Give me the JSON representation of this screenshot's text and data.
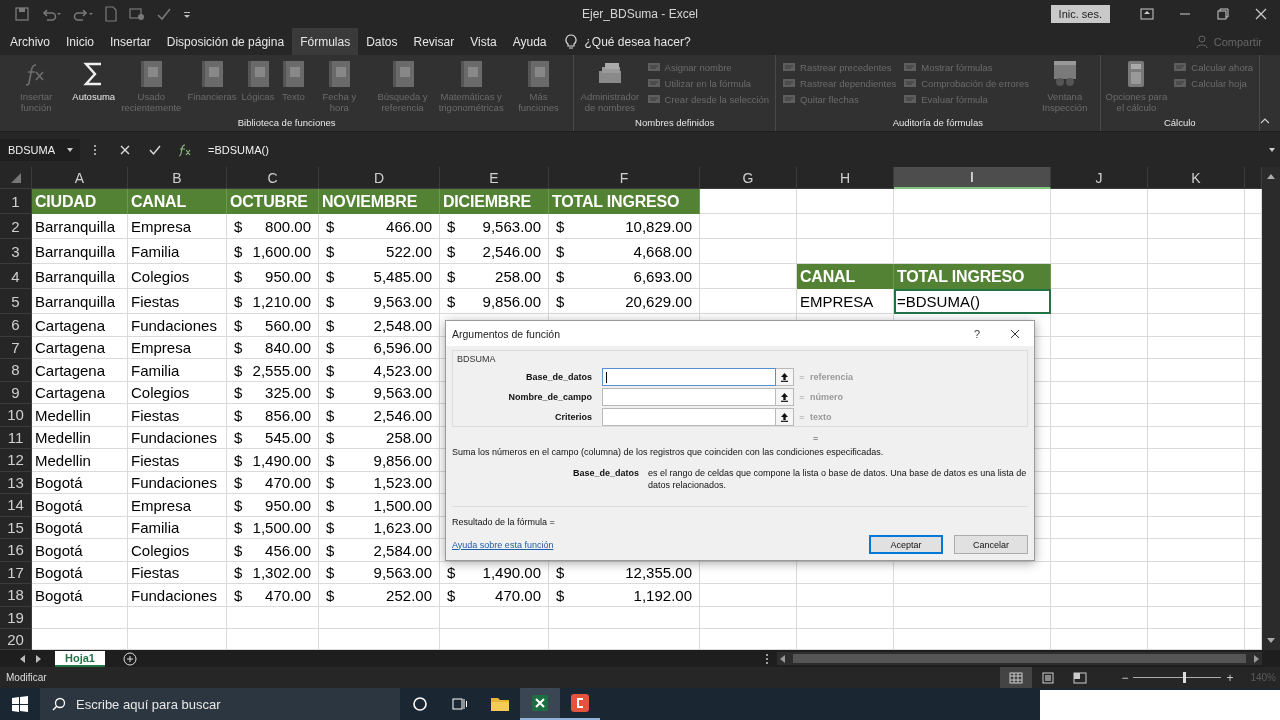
{
  "window": {
    "title": "Ejer_BDSuma  -  Excel",
    "sign_in": "Inic. ses."
  },
  "menu_tabs": [
    {
      "label": "Archivo",
      "selected": false
    },
    {
      "label": "Inicio",
      "selected": false
    },
    {
      "label": "Insertar",
      "selected": false
    },
    {
      "label": "Disposición de página",
      "selected": false
    },
    {
      "label": "Fórmulas",
      "selected": true
    },
    {
      "label": "Datos",
      "selected": false
    },
    {
      "label": "Revisar",
      "selected": false
    },
    {
      "label": "Vista",
      "selected": false
    },
    {
      "label": "Ayuda",
      "selected": false
    }
  ],
  "tell_me": "¿Qué desea hacer?",
  "share": {
    "label": "Compartir",
    "disabled": true
  },
  "ribbon": {
    "groups": [
      {
        "label": "Biblioteca de funciones",
        "items": [
          {
            "kind": "large",
            "label": "Insertar función",
            "disabled": true
          },
          {
            "kind": "large",
            "label": "Autosuma",
            "disabled": false
          },
          {
            "kind": "large",
            "label": "Usado recientemente",
            "disabled": true
          },
          {
            "kind": "large",
            "label": "Financieras",
            "disabled": true
          },
          {
            "kind": "large",
            "label": "Lógicas",
            "disabled": true
          },
          {
            "kind": "large",
            "label": "Texto",
            "disabled": true
          },
          {
            "kind": "large",
            "label": "Fecha y hora",
            "disabled": true
          },
          {
            "kind": "large",
            "label": "Búsqueda y referencia",
            "disabled": true
          },
          {
            "kind": "large",
            "label": "Matemáticas y trigonométricas",
            "disabled": true
          },
          {
            "kind": "large",
            "label": "Más funciones",
            "disabled": true
          }
        ]
      },
      {
        "label": "Nombres definidos",
        "items": [
          {
            "kind": "large",
            "label": "Administrador de nombres",
            "disabled": true
          },
          {
            "kind": "small",
            "label": "Asignar nombre",
            "disabled": true
          },
          {
            "kind": "small",
            "label": "Utilizar en la fórmula",
            "disabled": true
          },
          {
            "kind": "small",
            "label": "Crear desde la selección",
            "disabled": true
          }
        ]
      },
      {
        "label": "Auditoría de fórmulas",
        "items": [
          {
            "kind": "small",
            "label": "Rastrear precedentes",
            "disabled": true
          },
          {
            "kind": "small",
            "label": "Rastrear dependientes",
            "disabled": true
          },
          {
            "kind": "small",
            "label": "Quitar flechas",
            "disabled": true
          },
          {
            "kind": "small",
            "label": "Mostrar fórmulas",
            "disabled": true
          },
          {
            "kind": "small",
            "label": "Comprobación de errores",
            "disabled": true
          },
          {
            "kind": "small",
            "label": "Evaluar fórmula",
            "disabled": true
          },
          {
            "kind": "large",
            "label": "Ventana Inspección",
            "disabled": true
          }
        ]
      },
      {
        "label": "Cálculo",
        "items": [
          {
            "kind": "large",
            "label": "Opciones para el cálculo",
            "disabled": true
          },
          {
            "kind": "small",
            "label": "Calcular ahora",
            "disabled": true
          },
          {
            "kind": "small",
            "label": "Calcular hoja",
            "disabled": true
          }
        ]
      }
    ]
  },
  "formula_bar": {
    "name_box": "BDSUMA",
    "formula": "=BDSUMA()"
  },
  "sheet": {
    "columns": [
      {
        "label": "A",
        "selected": false
      },
      {
        "label": "B",
        "selected": false
      },
      {
        "label": "C",
        "selected": false
      },
      {
        "label": "D",
        "selected": false
      },
      {
        "label": "E",
        "selected": false
      },
      {
        "label": "F",
        "selected": false
      },
      {
        "label": "G",
        "selected": false
      },
      {
        "label": "H",
        "selected": false
      },
      {
        "label": "I",
        "selected": true
      },
      {
        "label": "J",
        "selected": false
      },
      {
        "label": "K",
        "selected": false
      }
    ],
    "rows": [
      {
        "number": "1",
        "cells": [
          {
            "kind": "header",
            "text": "CIUDAD"
          },
          {
            "kind": "header",
            "text": "CANAL"
          },
          {
            "kind": "header",
            "text": "OCTUBRE"
          },
          {
            "kind": "header",
            "text": "NOVIEMBRE"
          },
          {
            "kind": "header",
            "text": "DICIEMBRE"
          },
          {
            "kind": "header",
            "text": "TOTAL INGRESO"
          }
        ]
      },
      {
        "number": "2",
        "cells": [
          {
            "kind": "text",
            "text": "Barranquilla"
          },
          {
            "kind": "text",
            "text": "Empresa"
          },
          {
            "kind": "money",
            "currency": "$",
            "amount": "800.00"
          },
          {
            "kind": "money",
            "currency": "$",
            "amount": "466.00"
          },
          {
            "kind": "money",
            "currency": "$",
            "amount": "9,563.00"
          },
          {
            "kind": "money",
            "currency": "$",
            "amount": "10,829.00"
          }
        ]
      },
      {
        "number": "3",
        "cells": [
          {
            "kind": "text",
            "text": "Barranquilla"
          },
          {
            "kind": "text",
            "text": "Familia"
          },
          {
            "kind": "money",
            "currency": "$",
            "amount": "1,600.00"
          },
          {
            "kind": "money",
            "currency": "$",
            "amount": "522.00"
          },
          {
            "kind": "money",
            "currency": "$",
            "amount": "2,546.00"
          },
          {
            "kind": "money",
            "currency": "$",
            "amount": "4,668.00"
          }
        ]
      },
      {
        "number": "4",
        "cells": [
          {
            "kind": "text",
            "text": "Barranquilla"
          },
          {
            "kind": "text",
            "text": "Colegios"
          },
          {
            "kind": "money",
            "currency": "$",
            "amount": "950.00"
          },
          {
            "kind": "money",
            "currency": "$",
            "amount": "5,485.00"
          },
          {
            "kind": "money",
            "currency": "$",
            "amount": "258.00"
          },
          {
            "kind": "money",
            "currency": "$",
            "amount": "6,693.00"
          },
          null,
          {
            "kind": "header",
            "text": "CANAL"
          },
          {
            "kind": "header",
            "text": "TOTAL INGRESO"
          }
        ]
      },
      {
        "number": "5",
        "cells": [
          {
            "kind": "text",
            "text": "Barranquilla"
          },
          {
            "kind": "text",
            "text": "Fiestas"
          },
          {
            "kind": "money",
            "currency": "$",
            "amount": "1,210.00"
          },
          {
            "kind": "money",
            "currency": "$",
            "amount": "9,563.00"
          },
          {
            "kind": "money",
            "currency": "$",
            "amount": "9,856.00"
          },
          {
            "kind": "money",
            "currency": "$",
            "amount": "20,629.00"
          },
          null,
          {
            "kind": "text",
            "text": "EMPRESA"
          },
          {
            "kind": "editing",
            "text": "=BDSUMA()"
          }
        ]
      },
      {
        "number": "6",
        "cells": [
          {
            "kind": "text",
            "text": "Cartagena"
          },
          {
            "kind": "text",
            "text": "Fundaciones"
          },
          {
            "kind": "money",
            "currency": "$",
            "amount": "560.00"
          },
          {
            "kind": "money",
            "currency": "$",
            "amount": "2,548.00"
          }
        ]
      },
      {
        "number": "7",
        "cells": [
          {
            "kind": "text",
            "text": "Cartagena"
          },
          {
            "kind": "text",
            "text": "Empresa"
          },
          {
            "kind": "money",
            "currency": "$",
            "amount": "840.00"
          },
          {
            "kind": "money",
            "currency": "$",
            "amount": "6,596.00"
          }
        ]
      },
      {
        "number": "8",
        "cells": [
          {
            "kind": "text",
            "text": "Cartagena"
          },
          {
            "kind": "text",
            "text": "Familia"
          },
          {
            "kind": "money",
            "currency": "$",
            "amount": "2,555.00"
          },
          {
            "kind": "money",
            "currency": "$",
            "amount": "4,523.00"
          }
        ]
      },
      {
        "number": "9",
        "cells": [
          {
            "kind": "text",
            "text": "Cartagena"
          },
          {
            "kind": "text",
            "text": "Colegios"
          },
          {
            "kind": "money",
            "currency": "$",
            "amount": "325.00"
          },
          {
            "kind": "money",
            "currency": "$",
            "amount": "9,563.00"
          }
        ]
      },
      {
        "number": "10",
        "cells": [
          {
            "kind": "text",
            "text": "Medellin"
          },
          {
            "kind": "text",
            "text": "Fiestas"
          },
          {
            "kind": "money",
            "currency": "$",
            "amount": "856.00"
          },
          {
            "kind": "money",
            "currency": "$",
            "amount": "2,546.00"
          }
        ]
      },
      {
        "number": "11",
        "cells": [
          {
            "kind": "text",
            "text": "Medellin"
          },
          {
            "kind": "text",
            "text": "Fundaciones"
          },
          {
            "kind": "money",
            "currency": "$",
            "amount": "545.00"
          },
          {
            "kind": "money",
            "currency": "$",
            "amount": "258.00"
          }
        ]
      },
      {
        "number": "12",
        "cells": [
          {
            "kind": "text",
            "text": "Medellin"
          },
          {
            "kind": "text",
            "text": "Fiestas"
          },
          {
            "kind": "money",
            "currency": "$",
            "amount": "1,490.00"
          },
          {
            "kind": "money",
            "currency": "$",
            "amount": "9,856.00"
          }
        ]
      },
      {
        "number": "13",
        "cells": [
          {
            "kind": "text",
            "text": "Bogotá"
          },
          {
            "kind": "text",
            "text": "Fundaciones"
          },
          {
            "kind": "money",
            "currency": "$",
            "amount": "470.00"
          },
          {
            "kind": "money",
            "currency": "$",
            "amount": "1,523.00"
          }
        ]
      },
      {
        "number": "14",
        "cells": [
          {
            "kind": "text",
            "text": "Bogotá"
          },
          {
            "kind": "text",
            "text": "Empresa"
          },
          {
            "kind": "money",
            "currency": "$",
            "amount": "950.00"
          },
          {
            "kind": "money",
            "currency": "$",
            "amount": "1,500.00"
          }
        ]
      },
      {
        "number": "15",
        "cells": [
          {
            "kind": "text",
            "text": "Bogotá"
          },
          {
            "kind": "text",
            "text": "Familia"
          },
          {
            "kind": "money",
            "currency": "$",
            "amount": "1,500.00"
          },
          {
            "kind": "money",
            "currency": "$",
            "amount": "1,623.00"
          }
        ]
      },
      {
        "number": "16",
        "cells": [
          {
            "kind": "text",
            "text": "Bogotá"
          },
          {
            "kind": "text",
            "text": "Colegios"
          },
          {
            "kind": "money",
            "currency": "$",
            "amount": "456.00"
          },
          {
            "kind": "money",
            "currency": "$",
            "amount": "2,584.00"
          }
        ]
      },
      {
        "number": "17",
        "cells": [
          {
            "kind": "text",
            "text": "Bogotá"
          },
          {
            "kind": "text",
            "text": "Fiestas"
          },
          {
            "kind": "money",
            "currency": "$",
            "amount": "1,302.00"
          },
          {
            "kind": "money",
            "currency": "$",
            "amount": "9,563.00"
          },
          {
            "kind": "money",
            "currency": "$",
            "amount": "1,490.00"
          },
          {
            "kind": "money",
            "currency": "$",
            "amount": "12,355.00"
          }
        ]
      },
      {
        "number": "18",
        "cells": [
          {
            "kind": "text",
            "text": "Bogotá"
          },
          {
            "kind": "text",
            "text": "Fundaciones"
          },
          {
            "kind": "money",
            "currency": "$",
            "amount": "470.00"
          },
          {
            "kind": "money",
            "currency": "$",
            "amount": "252.00"
          },
          {
            "kind": "money",
            "currency": "$",
            "amount": "470.00"
          },
          {
            "kind": "money",
            "currency": "$",
            "amount": "1,192.00"
          }
        ]
      },
      {
        "number": "19",
        "cells": []
      },
      {
        "number": "20",
        "cells": []
      }
    ]
  },
  "dialog": {
    "title": "Argumentos de función",
    "help": "?",
    "function_name": "BDSUMA",
    "arguments": [
      {
        "label": "Base_de_datos",
        "focused": true,
        "equals": "=",
        "hint": "referencia"
      },
      {
        "label": "Nombre_de_campo",
        "focused": false,
        "equals": "=",
        "hint": "número"
      },
      {
        "label": "Criterios",
        "focused": false,
        "equals": "=",
        "hint": "texto"
      }
    ],
    "result_equals": "=",
    "description": "Suma los números en el campo (columna) de los registros que coinciden con las condiciones especificadas.",
    "argument_help": {
      "name": "Base_de_datos",
      "text": "es el rango de celdas que compone la lista o base de datos. Una base de datos es una lista de datos relacionados."
    },
    "formula_result": "Resultado de la fórmula =",
    "help_link": "Ayuda sobre esta función",
    "buttons": [
      {
        "label": "Aceptar",
        "default": true
      },
      {
        "label": "Cancelar",
        "default": false
      }
    ]
  },
  "sheet_tabs": [
    {
      "label": "Hoja1",
      "selected": true
    }
  ],
  "status_bar": {
    "mode": "Modificar",
    "zoom_out": "−",
    "zoom_in": "+",
    "zoom": {
      "level": 0.57,
      "label": "140%"
    }
  },
  "taskbar": {
    "search": {
      "placeholder": "Escribe aquí para buscar"
    },
    "apps": [
      {
        "active": false,
        "running": false
      },
      {
        "active": true,
        "running": true
      },
      {
        "active": false,
        "running": true
      }
    ]
  }
}
